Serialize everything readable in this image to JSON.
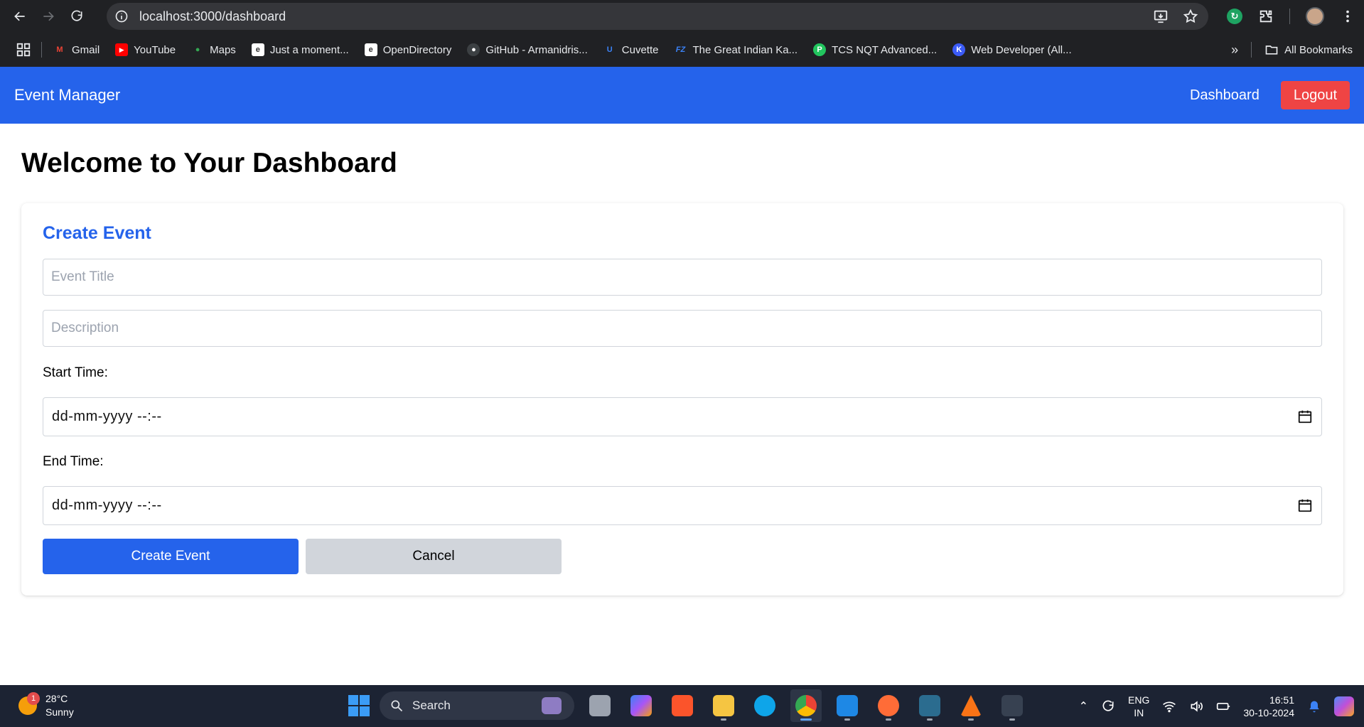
{
  "browser": {
    "url": "localhost:3000/dashboard",
    "bookmarks": [
      {
        "label": "Gmail",
        "icon": "gmail-icon",
        "color": "#ea4335"
      },
      {
        "label": "YouTube",
        "icon": "youtube-icon",
        "color": "#ff0000"
      },
      {
        "label": "Maps",
        "icon": "maps-icon",
        "color": "#34a853"
      },
      {
        "label": "Just a moment...",
        "icon": "page-icon",
        "color": "#ffffff"
      },
      {
        "label": "OpenDirectory",
        "icon": "page-icon",
        "color": "#ffffff"
      },
      {
        "label": "GitHub - Armanidris...",
        "icon": "github-icon",
        "color": "#ffffff"
      },
      {
        "label": "Cuvette",
        "icon": "cuvette-icon",
        "color": "#3b82f6"
      },
      {
        "label": "The Great Indian Ka...",
        "icon": "fz-icon",
        "color": "#3b82f6"
      },
      {
        "label": "TCS NQT Advanced...",
        "icon": "tcs-icon",
        "color": "#22c55e"
      },
      {
        "label": "Web Developer (All...",
        "icon": "kotlin-icon",
        "color": "#3b82f6"
      }
    ],
    "all_bookmarks_label": "All Bookmarks"
  },
  "app": {
    "brand": "Event Manager",
    "nav_dashboard": "Dashboard",
    "nav_logout": "Logout",
    "page_title": "Welcome to Your Dashboard",
    "form": {
      "heading": "Create Event",
      "title_placeholder": "Event Title",
      "description_placeholder": "Description",
      "start_label": "Start Time:",
      "start_value": "dd-mm-yyyy --:--",
      "end_label": "End Time:",
      "end_value": "dd-mm-yyyy --:--",
      "submit_label": "Create Event",
      "cancel_label": "Cancel"
    },
    "colors": {
      "primary": "#2563eb",
      "danger": "#ef4444",
      "secondary": "#d1d5db"
    }
  },
  "taskbar": {
    "weather_badge": "1",
    "temperature": "28°C",
    "condition": "Sunny",
    "search_placeholder": "Search",
    "lang_top": "ENG",
    "lang_bottom": "IN",
    "time": "16:51",
    "date": "30-10-2024"
  }
}
